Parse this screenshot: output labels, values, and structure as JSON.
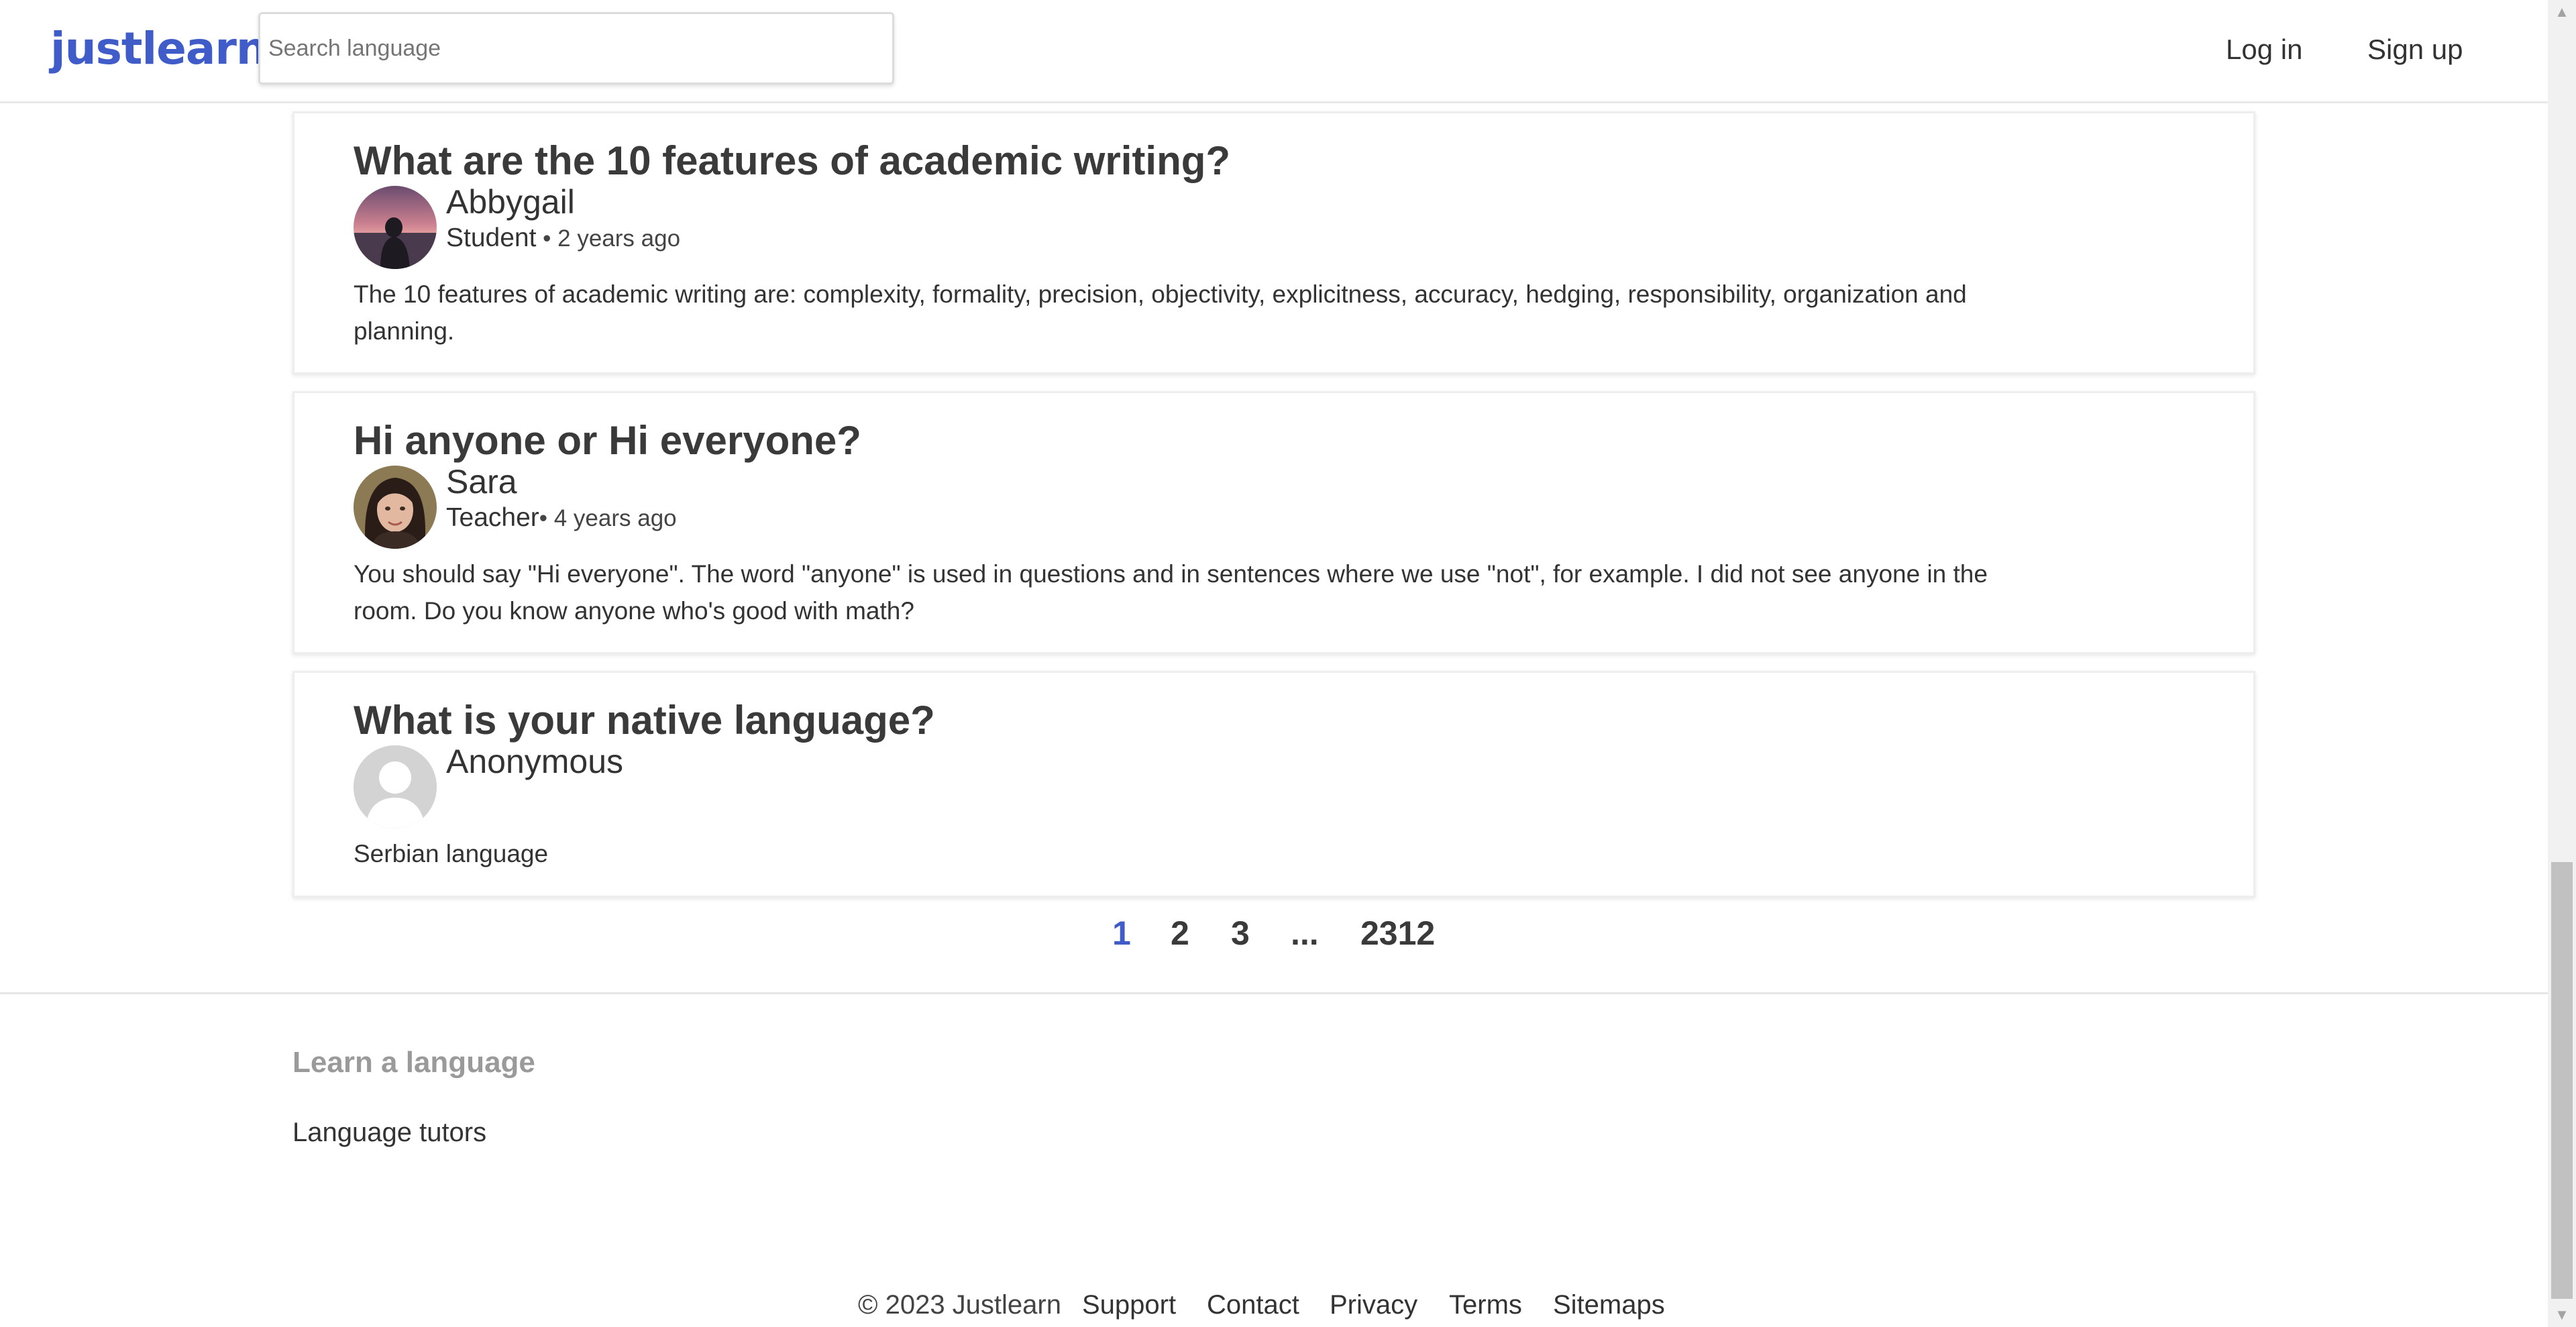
{
  "header": {
    "logo": "justlearn",
    "search_placeholder": "Search language",
    "login_label": "Log in",
    "signup_label": "Sign up"
  },
  "posts": [
    {
      "title": "What are the 10 features of academic writing?",
      "author": "Abbygail",
      "role": "Student",
      "separator": " • ",
      "time": "2 years ago",
      "avatar": "photo-avatar-sunset",
      "body": "The 10 features of academic writing are: complexity, formality, precision, objectivity, explicitness, accuracy, hedging, responsibility, organization and planning."
    },
    {
      "title": "Hi anyone or Hi everyone?",
      "author": "Sara",
      "role": "Teacher",
      "separator": "• ",
      "time": "4 years ago",
      "avatar": "photo-avatar-woman",
      "body": "You should say \"Hi everyone\". The word \"anyone\" is used in questions and in sentences where we use \"not\", for example. I did not see anyone in the room. Do you know anyone who's good with math?"
    },
    {
      "title": "What is your native language?",
      "author": "Anonymous",
      "avatar": "default-user-icon",
      "body": "Serbian language"
    }
  ],
  "pagination": {
    "current": "1",
    "pages": [
      "1",
      "2",
      "3",
      "...",
      "2312"
    ]
  },
  "footer": {
    "heading": "Learn a language",
    "tutors_link": "Language tutors",
    "copyright": "© 2023 Justlearn",
    "links": [
      "Support",
      "Contact",
      "Privacy",
      "Terms",
      "Sitemaps"
    ]
  },
  "colors": {
    "brand": "#3f5cc8",
    "text": "#333333",
    "muted_heading": "#9a9a9a"
  }
}
